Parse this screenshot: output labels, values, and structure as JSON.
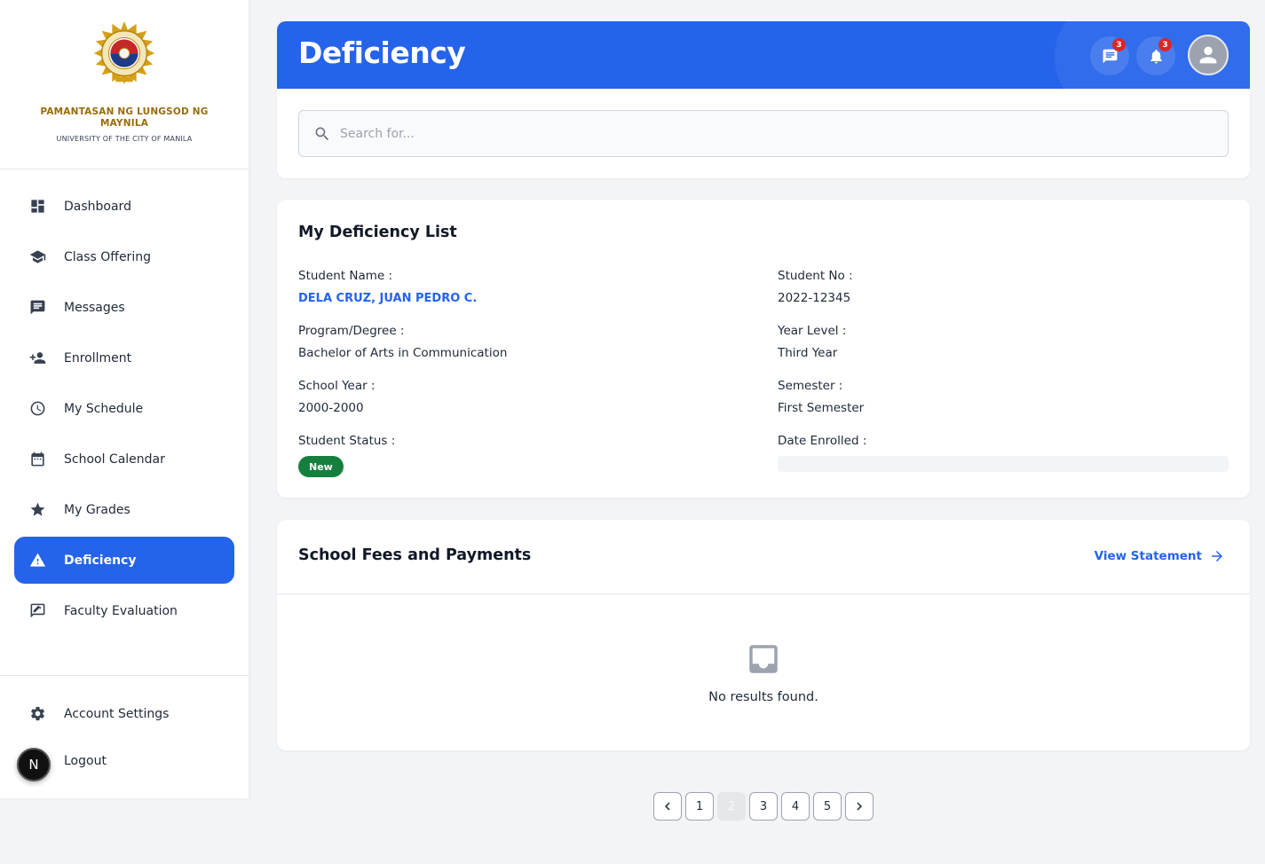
{
  "brand": {
    "name": "PAMANTASAN NG LUNGSOD NG MAYNILA",
    "subtitle": "UNIVERSITY OF THE CITY OF MANILA"
  },
  "sidebar": {
    "items": [
      {
        "label": "Dashboard",
        "icon": "dashboard-icon"
      },
      {
        "label": "Class Offering",
        "icon": "graduation-cap-icon"
      },
      {
        "label": "Messages",
        "icon": "message-icon"
      },
      {
        "label": "Enrollment",
        "icon": "person-add-icon"
      },
      {
        "label": "My Schedule",
        "icon": "clock-icon"
      },
      {
        "label": "School Calendar",
        "icon": "calendar-icon"
      },
      {
        "label": "My Grades",
        "icon": "star-icon"
      },
      {
        "label": "Deficiency",
        "icon": "warning-icon",
        "active": true
      },
      {
        "label": "Faculty Evaluation",
        "icon": "feedback-icon"
      }
    ],
    "bottom": [
      {
        "label": "Account Settings",
        "icon": "gear-icon"
      },
      {
        "label": "Logout",
        "icon": "logout-icon"
      }
    ],
    "avatar_letter": "N"
  },
  "header": {
    "title": "Deficiency",
    "messages_count": "3",
    "notifications_count": "3"
  },
  "search": {
    "placeholder": "Search for..."
  },
  "deficiency": {
    "title": "My Deficiency List",
    "student_name_label": "Student Name :",
    "student_name": "DELA CRUZ, JUAN PEDRO C.",
    "student_no_label": "Student No :",
    "student_no": "2022-12345",
    "program_label": "Program/Degree :",
    "program": "Bachelor of Arts in Communication",
    "year_level_label": "Year Level :",
    "year_level": "Third Year",
    "school_year_label": "School Year :",
    "school_year": "2000-2000",
    "semester_label": "Semester :",
    "semester": "First Semester",
    "status_label": "Student Status :",
    "status": "New",
    "date_enrolled_label": "Date Enrolled :"
  },
  "fees": {
    "title": "School Fees and Payments",
    "view_statement": "View Statement",
    "empty_message": "No results found."
  },
  "pagination": {
    "pages": [
      "1",
      "2",
      "3",
      "4",
      "5"
    ],
    "current": "2"
  },
  "colors": {
    "primary": "#2563eb",
    "brand_gold": "#9a6b0a",
    "status_green": "#15803d",
    "badge_red": "#dc2626"
  }
}
